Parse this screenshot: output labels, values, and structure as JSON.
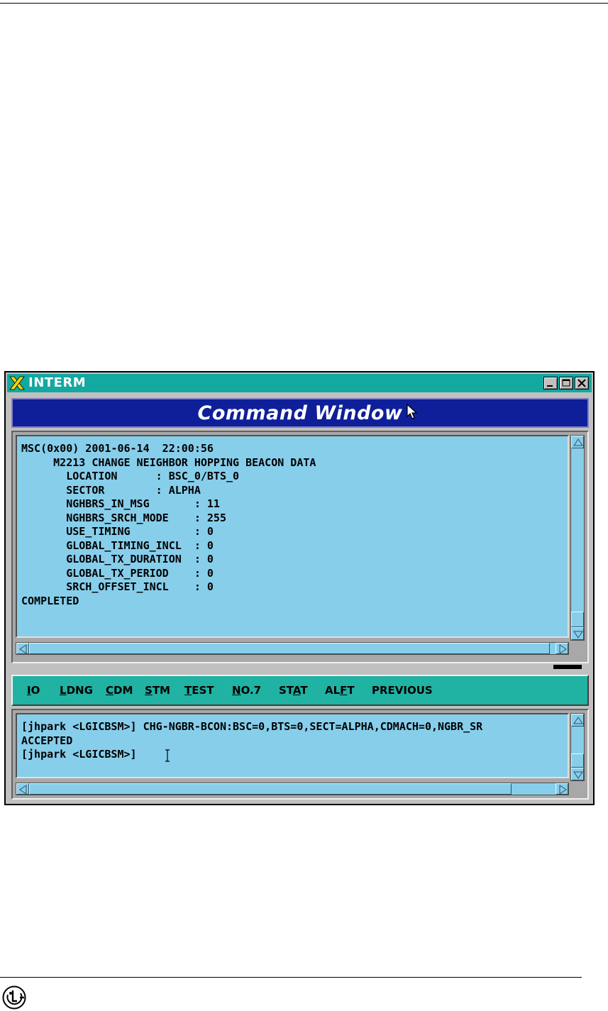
{
  "window": {
    "title": "INTERM",
    "controls": {
      "minimize": "minimize",
      "maximize": "maximize",
      "close": "close"
    }
  },
  "command_window": {
    "title": "Command Window"
  },
  "output": {
    "lines": [
      "MSC(0x00) 2001-06-14  22:00:56",
      "     M2213 CHANGE NEIGHBOR HOPPING BEACON DATA",
      "       LOCATION      : BSC_0/BTS_0",
      "       SECTOR        : ALPHA",
      "       NGHBRS_IN_MSG       : 11",
      "       NGHBRS_SRCH_MODE    : 255",
      "       USE_TIMING          : 0",
      "       GLOBAL_TIMING_INCL  : 0",
      "       GLOBAL_TX_DURATION  : 0",
      "       GLOBAL_TX_PERIOD    : 0",
      "       SRCH_OFFSET_INCL    : 0",
      "COMPLETED"
    ]
  },
  "menu": {
    "items": [
      {
        "label": "IO",
        "mnemonic": "I"
      },
      {
        "label": "LDNG",
        "mnemonic": "L"
      },
      {
        "label": "CDM",
        "mnemonic": "C"
      },
      {
        "label": "STM",
        "mnemonic": "S"
      },
      {
        "label": "TEST",
        "mnemonic": "T"
      },
      {
        "label": "NO.7",
        "mnemonic": "N"
      },
      {
        "label": "STAT",
        "mnemonic": "A"
      },
      {
        "label": "ALFT",
        "mnemonic": "F"
      },
      {
        "label": "PREVIOUS",
        "mnemonic": ""
      }
    ]
  },
  "input": {
    "lines": [
      "[jhpark <LGICBSM>] CHG-NGBR-BCON:BSC=0,BTS=0,SECT=ALPHA,CDMACH=0,NGBR_SR",
      "ACCEPTED",
      "[jhpark <LGICBSM>] "
    ]
  },
  "icons": {
    "title_icon": "x-logo-icon",
    "mouse_cursor": "arrow-cursor-icon",
    "text_cursor": "ibeam-cursor-icon",
    "footer_logo": "lg-logo-icon"
  },
  "colors": {
    "titlebar": "#13a8a0",
    "header": "#0f1f99",
    "terminal_bg": "#87ceeb",
    "menubar": "#20b2a2"
  }
}
